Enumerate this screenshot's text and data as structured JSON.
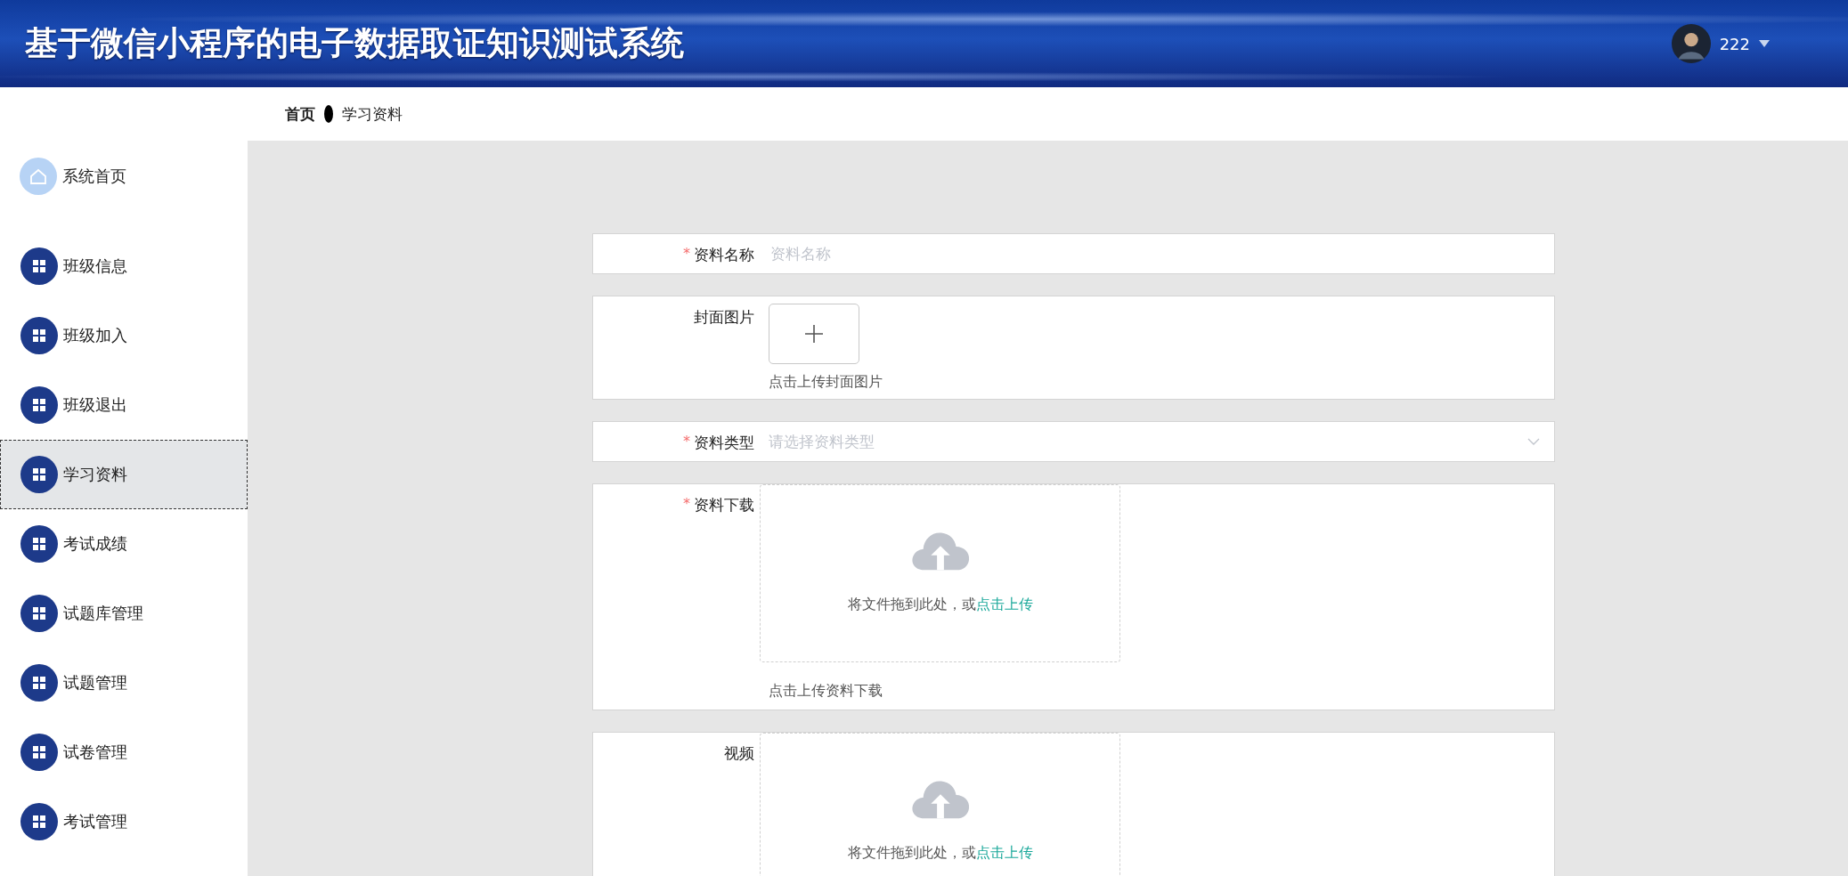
{
  "header": {
    "title": "基于微信小程序的电子数据取证知识测试系统",
    "user": "222"
  },
  "breadcrumb": [
    "首页",
    "学习资料"
  ],
  "sidebar": {
    "home": {
      "label": "系统首页"
    },
    "items": [
      {
        "label": "班级信息",
        "selected": false
      },
      {
        "label": "班级加入",
        "selected": false
      },
      {
        "label": "班级退出",
        "selected": false
      },
      {
        "label": "学习资料",
        "selected": true
      },
      {
        "label": "考试成绩",
        "selected": false
      },
      {
        "label": "试题库管理",
        "selected": false
      },
      {
        "label": "试题管理",
        "selected": false
      },
      {
        "label": "试卷管理",
        "selected": false
      },
      {
        "label": "考试管理",
        "selected": false
      }
    ]
  },
  "form": [
    {
      "kind": "text",
      "mark": "*",
      "label": "资料名称",
      "placeholder": "资料名称"
    },
    {
      "kind": "image",
      "label": "封面图片",
      "caption": "点击上传封面图片"
    },
    {
      "kind": "select",
      "mark": "*",
      "label": "资料类型",
      "placeholder": "请选择资料类型"
    },
    {
      "kind": "upload",
      "mark": "*",
      "label": "资料下载",
      "hint": "将文件拖到此处，或",
      "link": "点击上传",
      "caption": "点击上传资料下载"
    },
    {
      "kind": "upload",
      "label": "视频",
      "hint": "将文件拖到此处，或",
      "link": "点击上传"
    }
  ]
}
